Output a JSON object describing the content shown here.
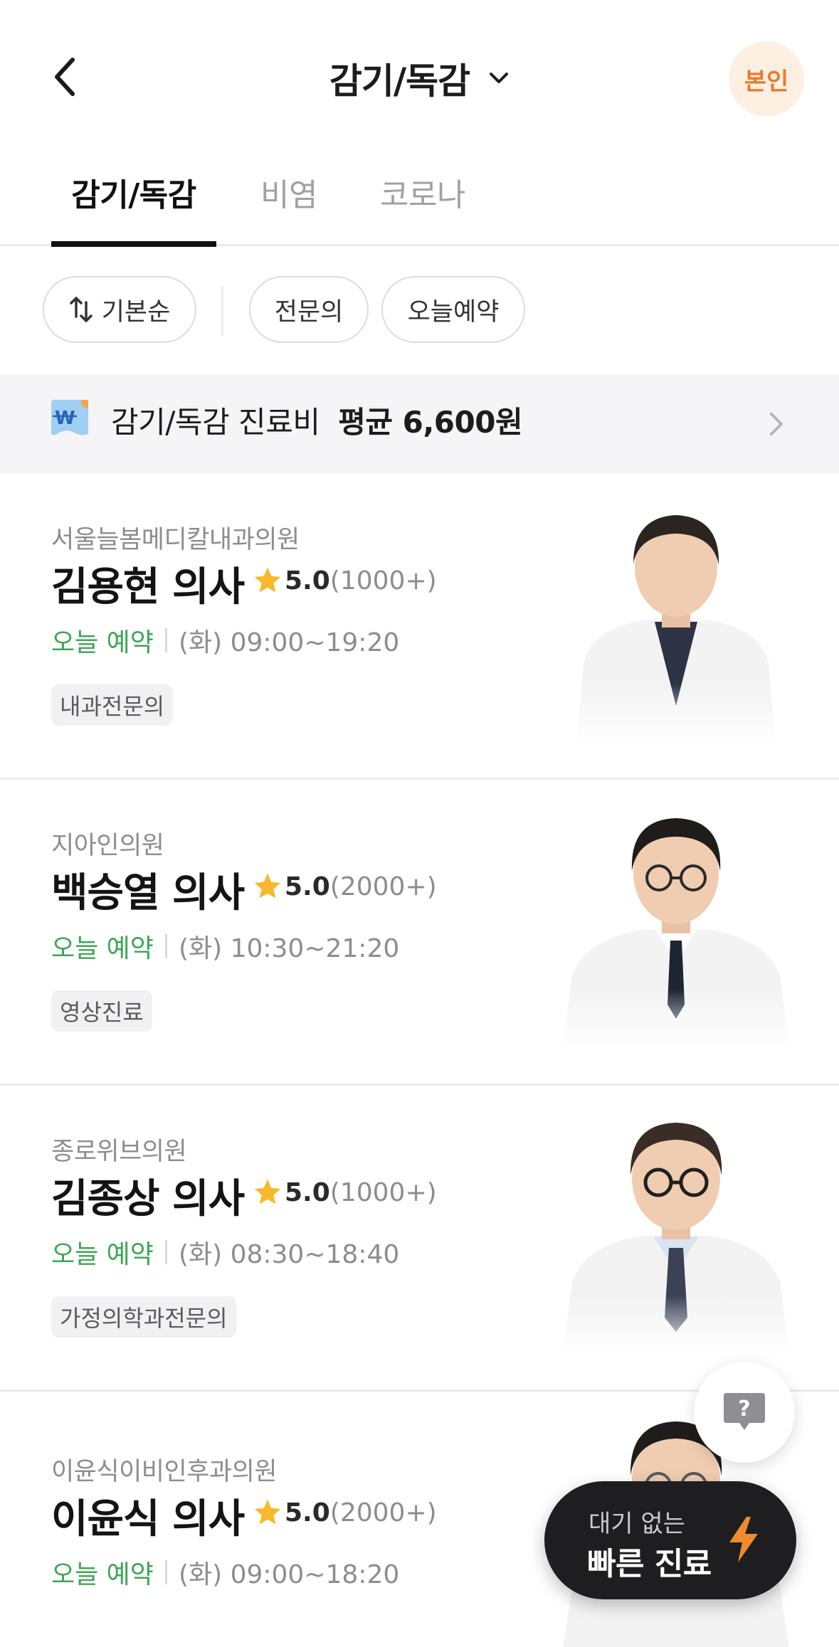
{
  "header": {
    "title": "감기/독감",
    "self_badge": "본인"
  },
  "tabs": [
    {
      "label": "감기/독감",
      "active": true
    },
    {
      "label": "비염",
      "active": false
    },
    {
      "label": "코로나",
      "active": false
    }
  ],
  "filters": {
    "sort_label": "기본순",
    "chips": [
      "전문의",
      "오늘예약"
    ]
  },
  "banner": {
    "prefix": "감기/독감 진료비",
    "price": "평균 6,600원"
  },
  "doctors": [
    {
      "clinic": "서울늘봄메디칼내과의원",
      "name": "김용현 의사",
      "rating": "5.0",
      "reviews": "(1000+)",
      "today": "오늘 예약",
      "hours": "(화) 09:00~19:20",
      "tag": "내과전문의"
    },
    {
      "clinic": "지아인의원",
      "name": "백승열 의사",
      "rating": "5.0",
      "reviews": "(2000+)",
      "today": "오늘 예약",
      "hours": "(화) 10:30~21:20",
      "tag": "영상진료"
    },
    {
      "clinic": "종로위브의원",
      "name": "김종상 의사",
      "rating": "5.0",
      "reviews": "(1000+)",
      "today": "오늘 예약",
      "hours": "(화) 08:30~18:40",
      "tag": "가정의학과전문의"
    },
    {
      "clinic": "이윤식이비인후과의원",
      "name": "이윤식 의사",
      "rating": "5.0",
      "reviews": "(2000+)",
      "today": "오늘 예약",
      "hours": "(화) 09:00~18:20",
      "tag": ""
    }
  ],
  "quick_fab": {
    "sub": "대기 없는",
    "main": "빠른 진료"
  },
  "colors": {
    "accent_orange": "#ec7a2b",
    "available_green": "#3fa555",
    "star_yellow": "#f7b92b"
  },
  "icons": [
    "back-icon",
    "chevron-down-icon",
    "sort-icon",
    "price-icon",
    "chevron-right-icon",
    "star-icon",
    "help-icon",
    "lightning-icon"
  ]
}
